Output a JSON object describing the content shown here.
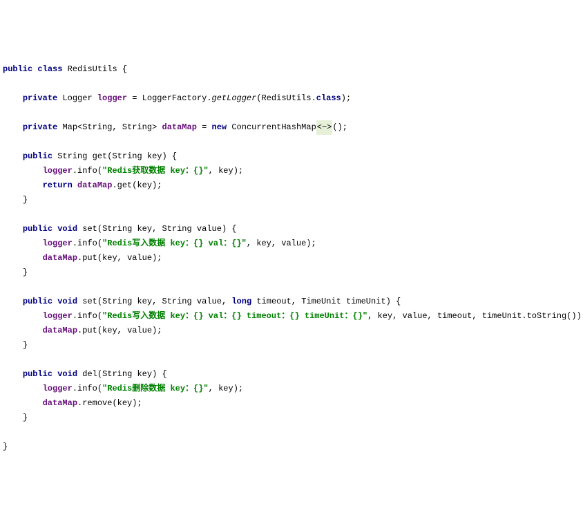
{
  "tokens": {
    "kw_public": "public",
    "kw_class": "class",
    "kw_private": "private",
    "kw_void": "void",
    "kw_return": "return",
    "kw_new": "new",
    "kw_long": "long",
    "kw_class2": "class",
    "cls_RedisUtils": "RedisUtils",
    "type_Logger": "Logger",
    "field_logger": "logger",
    "eq": " = ",
    "cls_LoggerFactory": "LoggerFactory",
    "dot": ".",
    "m_getLogger": "getLogger",
    "lpar": "(",
    "rpar": ")",
    "semi": ";",
    "type_Map": "Map",
    "lt": "<",
    "gt": ">",
    "type_String": "String",
    "comma": ", ",
    "field_dataMap": "dataMap",
    "cls_ConcurrentHashMap": "ConcurrentHashMap",
    "diamond": "<~>",
    "empty_args": "()",
    "m_get": "get",
    "p_key": "key",
    "p_value": "value",
    "p_timeout": "timeout",
    "p_timeUnit": "timeUnit",
    "type_TimeUnit": "TimeUnit",
    "m_info": "info",
    "m_put": "put",
    "m_remove": "remove",
    "m_set": "set",
    "m_del": "del",
    "m_toString": "toString",
    "lbrace": "{",
    "rbrace": "}",
    "sp": " ",
    "str_get": "\"Redis获取数据 key：{}\"",
    "str_set": "\"Redis写入数据 key：{} val：{}\"",
    "str_set2": "\"Redis写入数据 key：{} val：{} timeout：{} timeUnit：{}\"",
    "str_del": "\"Redis删除数据 key：{}\""
  },
  "chart_data": null
}
